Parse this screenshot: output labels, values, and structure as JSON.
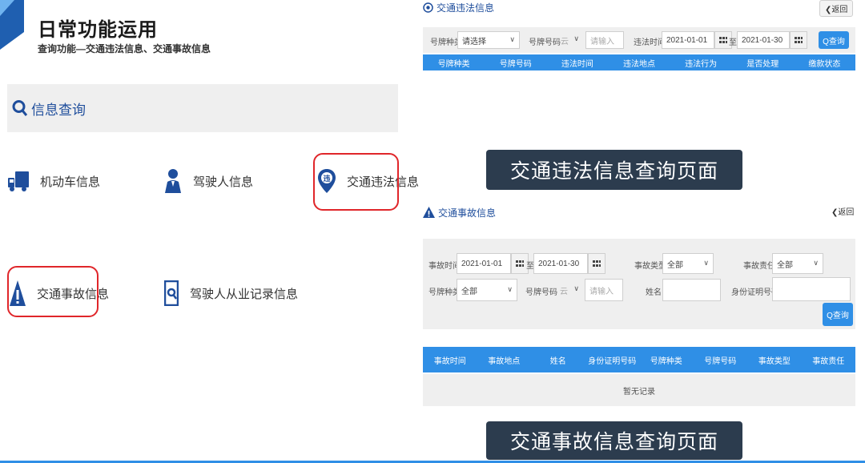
{
  "slide": {
    "title": "日常功能运用",
    "subtitle": "查询功能—交通违法信息、交通事故信息"
  },
  "left_panel": {
    "section_label": "信息查询",
    "items": [
      {
        "label": "机动车信息",
        "icon": "truck-icon"
      },
      {
        "label": "驾驶人信息",
        "icon": "driver-person-icon"
      },
      {
        "label": "交通违法信息",
        "icon": "violation-pin-icon"
      },
      {
        "label": "交通事故信息",
        "icon": "warning-triangle-icon"
      },
      {
        "label": "驾驶人从业记录信息",
        "icon": "document-search-icon"
      }
    ]
  },
  "violation_panel": {
    "title": "交通违法信息",
    "back": "返回",
    "filters": {
      "plate_type_label": "号牌种类",
      "plate_type_value": "请选择",
      "plate_no_label": "号牌号码",
      "plate_prefix": "云",
      "plate_placeholder": "请输入",
      "time_label": "违法时间",
      "date_from": "2021-01-01",
      "to": "至",
      "date_to": "2021-01-30",
      "query": "Q查询"
    },
    "columns": [
      "号牌种类",
      "号牌号码",
      "违法时间",
      "违法地点",
      "违法行为",
      "是否处理",
      "缴款状态"
    ],
    "caption": "交通违法信息查询页面"
  },
  "accident_panel": {
    "title": "交通事故信息",
    "back": "返回",
    "filters": {
      "time_label": "事故时间",
      "date_from": "2021-01-01",
      "to": "至",
      "date_to": "2021-01-30",
      "type_label": "事故类型",
      "type_value": "全部",
      "resp_label": "事故责任",
      "resp_value": "全部",
      "plate_type_label": "号牌种类",
      "plate_type_value": "全部",
      "plate_no_label": "号牌号码",
      "plate_prefix": "云",
      "plate_placeholder": "请输入",
      "name_label": "姓名",
      "id_label": "身份证明号码",
      "query": "Q查询"
    },
    "columns": [
      "事故时间",
      "事故地点",
      "姓名",
      "身份证明号码",
      "号牌种类",
      "号牌号码",
      "事故类型",
      "事故责任"
    ],
    "empty": "暂无记录",
    "caption": "交通事故信息查询页面"
  },
  "colors": {
    "accent": "#2f8fe6",
    "brand_blue": "#1f4e9c",
    "highlight_red": "#e0262a",
    "caption_bg": "#2c3c4e"
  }
}
